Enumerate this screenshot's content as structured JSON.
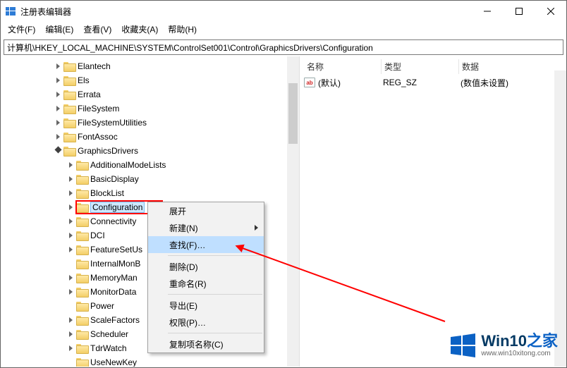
{
  "window": {
    "title": "注册表编辑器"
  },
  "menubar": [
    "文件(F)",
    "编辑(E)",
    "查看(V)",
    "收藏夹(A)",
    "帮助(H)"
  ],
  "path": "计算机\\HKEY_LOCAL_MACHINE\\SYSTEM\\ControlSet001\\Control\\GraphicsDrivers\\Configuration",
  "tree": [
    {
      "depth": 4,
      "exp": "closed",
      "label": "Elantech"
    },
    {
      "depth": 4,
      "exp": "closed",
      "label": "Els"
    },
    {
      "depth": 4,
      "exp": "closed",
      "label": "Errata"
    },
    {
      "depth": 4,
      "exp": "closed",
      "label": "FileSystem"
    },
    {
      "depth": 4,
      "exp": "closed",
      "label": "FileSystemUtilities"
    },
    {
      "depth": 4,
      "exp": "closed",
      "label": "FontAssoc"
    },
    {
      "depth": 4,
      "exp": "open",
      "label": "GraphicsDrivers"
    },
    {
      "depth": 5,
      "exp": "closed",
      "label": "AdditionalModeLists"
    },
    {
      "depth": 5,
      "exp": "closed",
      "label": "BasicDisplay"
    },
    {
      "depth": 5,
      "exp": "closed",
      "label": "BlockList"
    },
    {
      "depth": 5,
      "exp": "closed",
      "label": "Configuration",
      "selected": true
    },
    {
      "depth": 5,
      "exp": "closed",
      "label": "Connectivity"
    },
    {
      "depth": 5,
      "exp": "closed",
      "label": "DCI"
    },
    {
      "depth": 5,
      "exp": "closed",
      "label": "FeatureSetUsage",
      "displayLabel": "FeatureSetUs"
    },
    {
      "depth": 5,
      "exp": "",
      "label": "InternalMonBehavior",
      "displayLabel": "InternalMonB"
    },
    {
      "depth": 5,
      "exp": "closed",
      "label": "MemoryManager",
      "displayLabel": "MemoryMan"
    },
    {
      "depth": 5,
      "exp": "closed",
      "label": "MonitorDataStore",
      "displayLabel": "MonitorData"
    },
    {
      "depth": 5,
      "exp": "",
      "label": "Power"
    },
    {
      "depth": 5,
      "exp": "closed",
      "label": "ScaleFactors"
    },
    {
      "depth": 5,
      "exp": "closed",
      "label": "Scheduler"
    },
    {
      "depth": 5,
      "exp": "closed",
      "label": "TdrWatch"
    },
    {
      "depth": 5,
      "exp": "",
      "label": "UseNewKey"
    }
  ],
  "columns": {
    "name": "名称",
    "type": "类型",
    "data": "数据"
  },
  "values": [
    {
      "icon": "ab",
      "name": "(默认)",
      "type": "REG_SZ",
      "data": "(数值未设置)"
    }
  ],
  "context_menu": [
    {
      "label": "展开",
      "kind": "item"
    },
    {
      "label": "新建(N)",
      "kind": "submenu"
    },
    {
      "label": "查找(F)…",
      "kind": "item",
      "highlight": true
    },
    {
      "kind": "divider"
    },
    {
      "label": "删除(D)",
      "kind": "item"
    },
    {
      "label": "重命名(R)",
      "kind": "item"
    },
    {
      "kind": "divider"
    },
    {
      "label": "导出(E)",
      "kind": "item"
    },
    {
      "label": "权限(P)…",
      "kind": "item"
    },
    {
      "kind": "divider"
    },
    {
      "label": "复制项名称(C)",
      "kind": "item"
    }
  ],
  "watermark": {
    "brand": "Win10",
    "suffix": "之家",
    "url": "www.win10xitong.com"
  }
}
